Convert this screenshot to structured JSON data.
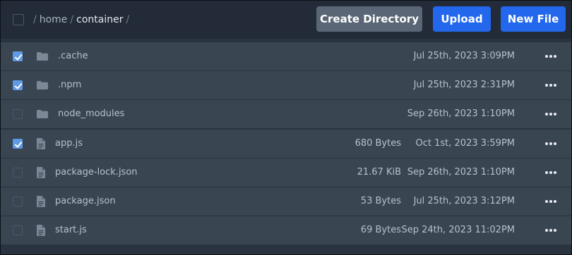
{
  "header": {
    "breadcrumb": [
      {
        "label": "home"
      },
      {
        "label": "container"
      }
    ],
    "separator": "/",
    "buttons": {
      "create_directory": "Create Directory",
      "upload": "Upload",
      "new_file": "New File"
    },
    "select_all_checked": false
  },
  "colors": {
    "accent_blue": "#2368ec",
    "button_gray": "#5a6675",
    "checkbox_checked": "#5f9ae6",
    "row_background": "#3a4552",
    "header_background": "#222b37"
  },
  "files": [
    {
      "name": ".cache",
      "type": "folder",
      "size": "",
      "modified": "Jul 25th, 2023 3:09PM",
      "checked": true
    },
    {
      "name": ".npm",
      "type": "folder",
      "size": "",
      "modified": "Jul 25th, 2023 2:31PM",
      "checked": true
    },
    {
      "name": "node_modules",
      "type": "folder",
      "size": "",
      "modified": "Sep 26th, 2023 1:10PM",
      "checked": false
    },
    {
      "name": "app.js",
      "type": "file",
      "size": "680 Bytes",
      "modified": "Oct 1st, 2023 3:59PM",
      "checked": true
    },
    {
      "name": "package-lock.json",
      "type": "file",
      "size": "21.67 KiB",
      "modified": "Sep 26th, 2023 1:10PM",
      "checked": false
    },
    {
      "name": "package.json",
      "type": "file",
      "size": "53 Bytes",
      "modified": "Jul 25th, 2023 3:12PM",
      "checked": false
    },
    {
      "name": "start.js",
      "type": "file",
      "size": "69 Bytes",
      "modified": "Sep 24th, 2023 11:02PM",
      "checked": false
    }
  ]
}
